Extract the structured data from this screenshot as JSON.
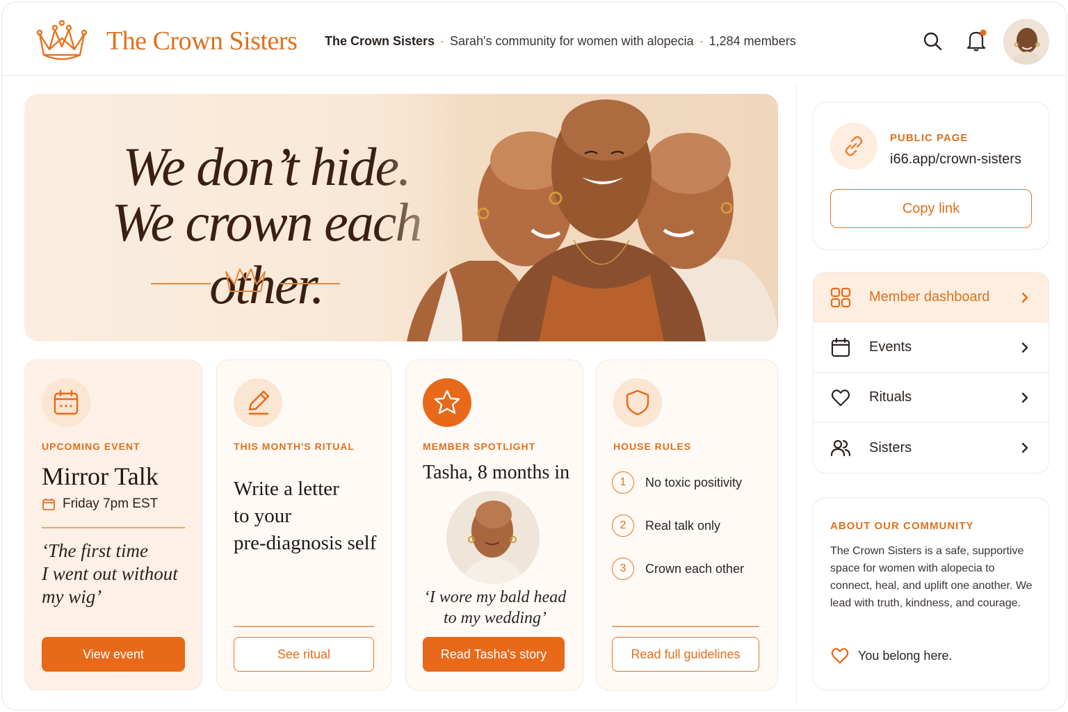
{
  "header": {
    "brand": "The Crown Sisters",
    "community_name": "The Crown Sisters",
    "community_desc": "Sarah's community for women with alopecia",
    "member_count": "1,284 members",
    "separator": "·"
  },
  "hero": {
    "line1": "We don’t hide.",
    "line2": "We crown each other."
  },
  "cards": {
    "event": {
      "eyebrow": "UPCOMING EVENT",
      "title": "Mirror Talk",
      "date": "Friday 7pm EST",
      "quote_l1": "‘The first time",
      "quote_l2": "I went out without",
      "quote_l3": "my wig’",
      "button": "View event"
    },
    "ritual": {
      "eyebrow": "THIS MONTH'S RITUAL",
      "l1": "Write a letter",
      "l2": "to your",
      "l3": "pre-diagnosis self",
      "button": "See ritual"
    },
    "spotlight": {
      "eyebrow": "MEMBER SPOTLIGHT",
      "title": "Tasha, 8 months in",
      "quote_l1": "‘I wore my bald head",
      "quote_l2": "to my wedding’",
      "button": "Read Tasha's story"
    },
    "rules": {
      "eyebrow": "HOUSE RULES",
      "items": [
        {
          "num": "1",
          "label": "No toxic positivity"
        },
        {
          "num": "2",
          "label": "Real talk only"
        },
        {
          "num": "3",
          "label": "Crown each other"
        }
      ],
      "button": "Read full guidelines"
    }
  },
  "sidebar": {
    "public_page": {
      "eyebrow": "PUBLIC PAGE",
      "url": "i66.app/crown-sisters",
      "button": "Copy link"
    },
    "nav": [
      {
        "label": "Member dashboard",
        "icon": "grid-icon"
      },
      {
        "label": "Events",
        "icon": "calendar-icon"
      },
      {
        "label": "Rituals",
        "icon": "heart-icon"
      },
      {
        "label": "Sisters",
        "icon": "users-icon"
      }
    ],
    "about": {
      "eyebrow": "ABOUT OUR COMMUNITY",
      "text": "The Crown Sisters is a safe, supportive space for women with alopecia to connect, heal, and uplift one another. We lead with truth, kindness, and courage.",
      "belong": "You belong here."
    }
  },
  "colors": {
    "accent": "#e8691a",
    "accent_text": "#e0701c",
    "hero_bg": "#f9e8d6",
    "heading": "#3a1f12"
  }
}
